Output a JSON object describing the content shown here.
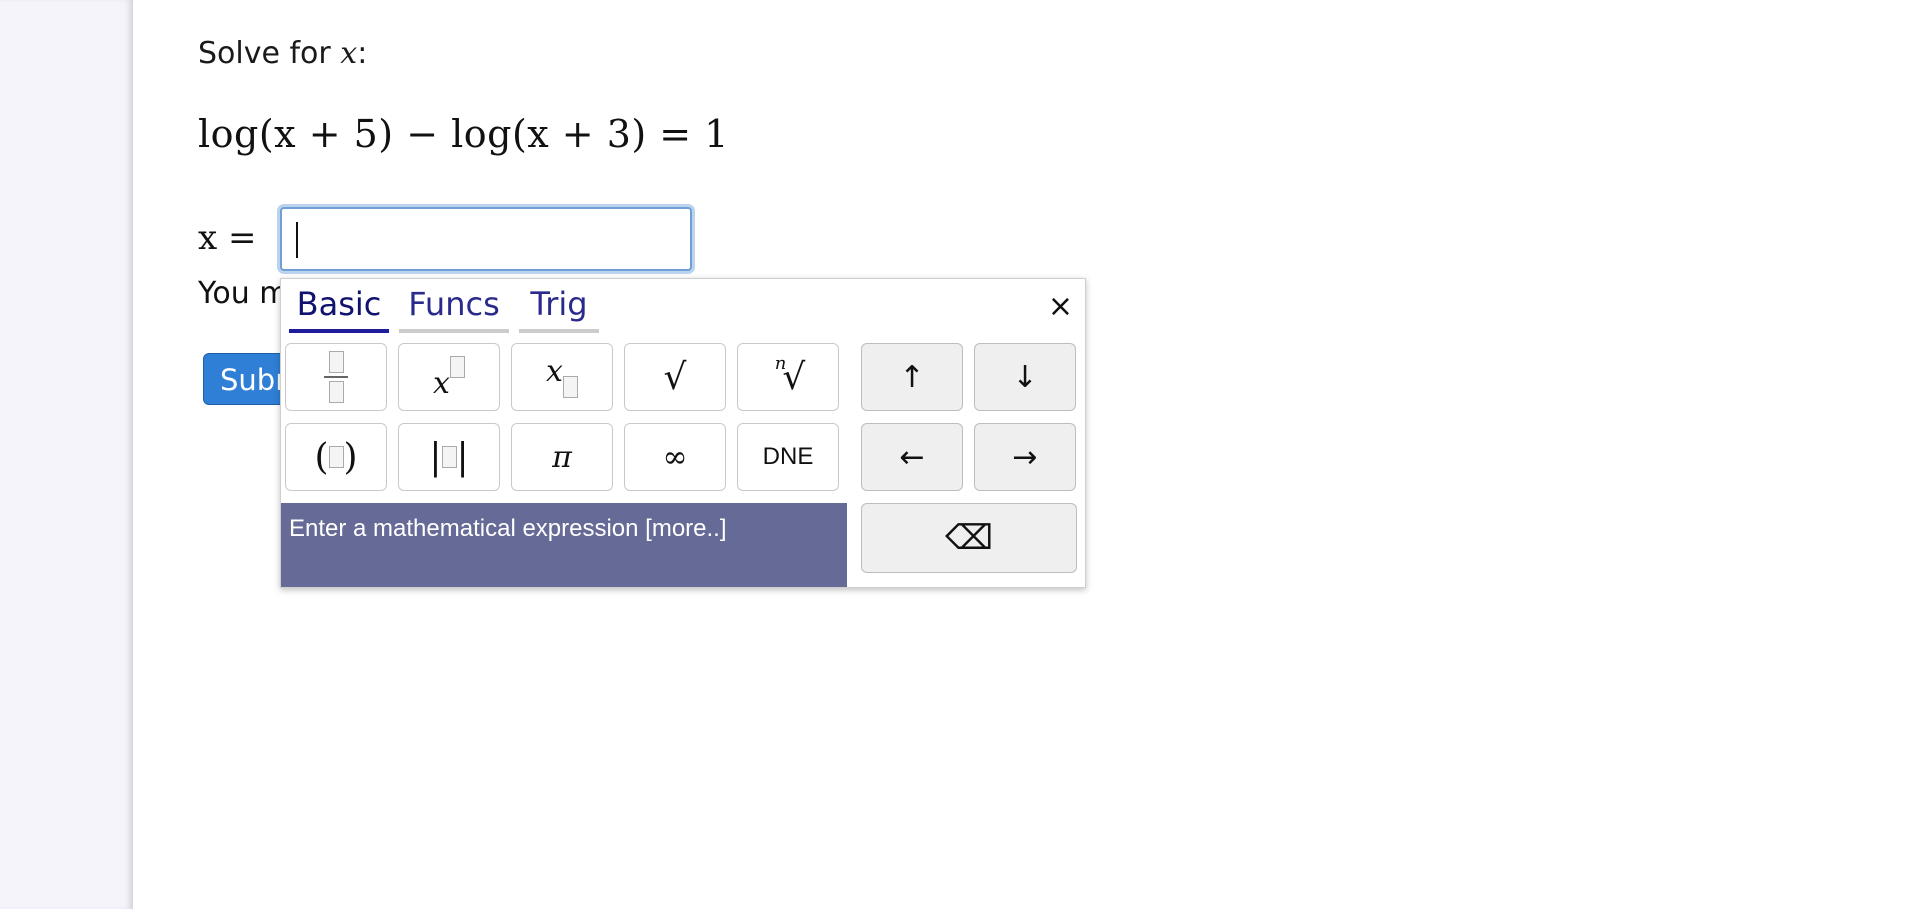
{
  "question": {
    "prompt_text": "Solve for ",
    "prompt_var": "x",
    "prompt_colon": ":",
    "equation": "log(x + 5) − log(x + 3) = 1",
    "answer_label": "x =",
    "answer_value": "",
    "note": "You m",
    "submit_label": "Subr"
  },
  "keyboard": {
    "tabs": [
      "Basic",
      "Funcs",
      "Trig"
    ],
    "active_tab": "Basic",
    "close_label": "×",
    "keys": {
      "fraction": "fraction",
      "power_base": "x",
      "subscript_base": "x",
      "sqrt": "√",
      "nth_root_index": "n",
      "nth_root": "√",
      "up": "↑",
      "down": "↓",
      "paren_open": "(",
      "paren_close": ")",
      "abs_bar": "|",
      "pi": "π",
      "infinity": "∞",
      "dne": "DNE",
      "left": "←",
      "right": "→",
      "backspace": "⌫"
    },
    "help_text": "Enter a mathematical expression [more..]"
  }
}
